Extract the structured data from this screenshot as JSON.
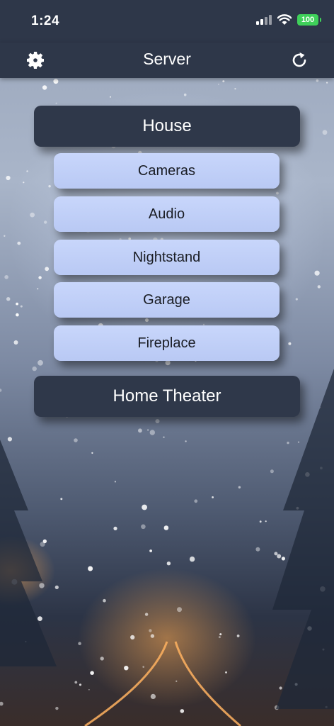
{
  "status_bar": {
    "time": "1:24",
    "battery": "100"
  },
  "nav": {
    "title": "Server",
    "left_icon": "gear-icon",
    "right_icon": "refresh-icon"
  },
  "menu": {
    "group_1": "House",
    "devices": [
      "Cameras",
      "Audio",
      "Nightstand",
      "Garage",
      "Fireplace"
    ],
    "group_2": "Home Theater"
  },
  "colors": {
    "bar_bg": "#2e3749",
    "group_button": "#2f384a",
    "device_button": "#c8d6fb",
    "battery_green": "#3fd05a"
  }
}
